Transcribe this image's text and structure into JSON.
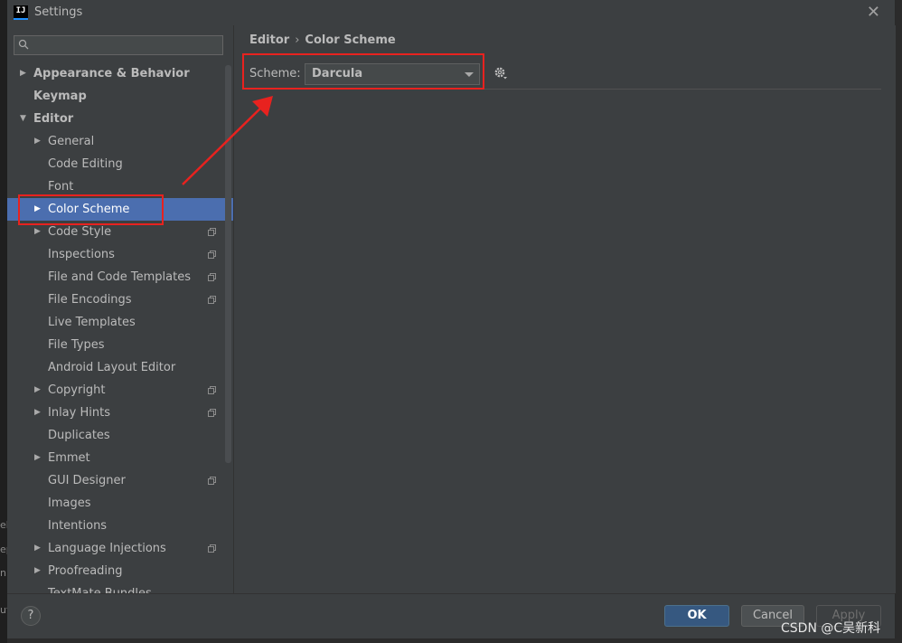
{
  "window": {
    "title": "Settings",
    "app_icon_text": "IJ",
    "close_symbol": "✕"
  },
  "background_fragments": [
    "eb",
    "ep",
    "n",
    "ut"
  ],
  "sidebar": {
    "search_placeholder": "",
    "items": [
      {
        "label": "Appearance & Behavior",
        "level": 0,
        "arrow": "▶",
        "bold": true,
        "copy": false
      },
      {
        "label": "Keymap",
        "level": 0,
        "arrow": "",
        "bold": true,
        "copy": false
      },
      {
        "label": "Editor",
        "level": 0,
        "arrow": "▼",
        "bold": true,
        "copy": false
      },
      {
        "label": "General",
        "level": 1,
        "arrow": "▶",
        "bold": false,
        "copy": false
      },
      {
        "label": "Code Editing",
        "level": 1,
        "arrow": "",
        "bold": false,
        "copy": false
      },
      {
        "label": "Font",
        "level": 1,
        "arrow": "",
        "bold": false,
        "copy": false
      },
      {
        "label": "Color Scheme",
        "level": 1,
        "arrow": "▶",
        "bold": false,
        "copy": false,
        "selected": true
      },
      {
        "label": "Code Style",
        "level": 1,
        "arrow": "▶",
        "bold": false,
        "copy": true
      },
      {
        "label": "Inspections",
        "level": 1,
        "arrow": "",
        "bold": false,
        "copy": true
      },
      {
        "label": "File and Code Templates",
        "level": 1,
        "arrow": "",
        "bold": false,
        "copy": true
      },
      {
        "label": "File Encodings",
        "level": 1,
        "arrow": "",
        "bold": false,
        "copy": true
      },
      {
        "label": "Live Templates",
        "level": 1,
        "arrow": "",
        "bold": false,
        "copy": false
      },
      {
        "label": "File Types",
        "level": 1,
        "arrow": "",
        "bold": false,
        "copy": false
      },
      {
        "label": "Android Layout Editor",
        "level": 1,
        "arrow": "",
        "bold": false,
        "copy": false
      },
      {
        "label": "Copyright",
        "level": 1,
        "arrow": "▶",
        "bold": false,
        "copy": true
      },
      {
        "label": "Inlay Hints",
        "level": 1,
        "arrow": "▶",
        "bold": false,
        "copy": true
      },
      {
        "label": "Duplicates",
        "level": 1,
        "arrow": "",
        "bold": false,
        "copy": false
      },
      {
        "label": "Emmet",
        "level": 1,
        "arrow": "▶",
        "bold": false,
        "copy": false
      },
      {
        "label": "GUI Designer",
        "level": 1,
        "arrow": "",
        "bold": false,
        "copy": true
      },
      {
        "label": "Images",
        "level": 1,
        "arrow": "",
        "bold": false,
        "copy": false
      },
      {
        "label": "Intentions",
        "level": 1,
        "arrow": "",
        "bold": false,
        "copy": false
      },
      {
        "label": "Language Injections",
        "level": 1,
        "arrow": "▶",
        "bold": false,
        "copy": true
      },
      {
        "label": "Proofreading",
        "level": 1,
        "arrow": "▶",
        "bold": false,
        "copy": false
      },
      {
        "label": "TextMate Bundles",
        "level": 1,
        "arrow": "",
        "bold": false,
        "copy": false
      }
    ]
  },
  "content": {
    "breadcrumb": [
      "Editor",
      "Color Scheme"
    ],
    "breadcrumb_separator": "›",
    "scheme_label": "Scheme:",
    "scheme_value": "Darcula"
  },
  "footer": {
    "help": "?",
    "ok": "OK",
    "cancel": "Cancel",
    "apply": "Apply"
  },
  "watermark": "CSDN @C吴新科",
  "colors": {
    "annotation": "#e8221f",
    "selection": "#4b6eaf",
    "ok_button": "#365880"
  }
}
